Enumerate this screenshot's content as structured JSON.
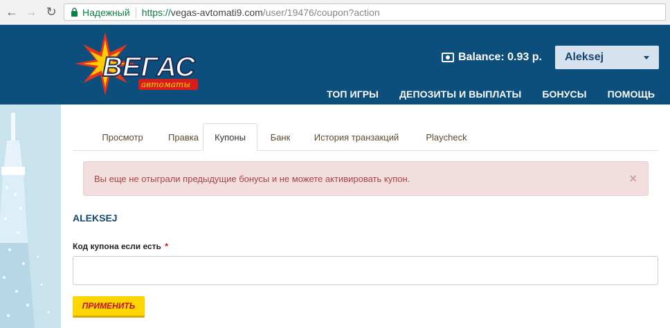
{
  "browser": {
    "secure_label": "Надежный",
    "url_scheme": "https://",
    "url_host": "vegas-avtomati9.com",
    "url_path": "/user/19476/coupon?action"
  },
  "header": {
    "logo_text": "ВЕГАС",
    "logo_subtext": "автоматы",
    "balance": "Balance: 0.93 р.",
    "user_name": "Aleksej",
    "nav": [
      "ТОП ИГРЫ",
      "ДЕПОЗИТЫ И ВЫПЛАТЫ",
      "БОНУСЫ",
      "ПОМОЩЬ"
    ]
  },
  "tabs": [
    {
      "label": "Просмотр",
      "active": false
    },
    {
      "label": "Правка",
      "active": false
    },
    {
      "label": "Купоны",
      "active": true
    },
    {
      "label": "Банк",
      "active": false
    },
    {
      "label": "История транзакций",
      "active": false
    },
    {
      "label": "Playcheck",
      "active": false
    }
  ],
  "alert": {
    "message": "Вы еще не отыграли предыдущие бонусы и не можете активировать купон.",
    "close": "×"
  },
  "form": {
    "username": "ALEKSEJ",
    "coupon_label": "Код купона если есть",
    "required_mark": "*",
    "coupon_value": "",
    "apply_label": "ПРИМЕНИТЬ"
  },
  "colors": {
    "header_bg": "#0c4e7c",
    "alert_bg": "#f2dede",
    "alert_text": "#a94442",
    "button_bg": "#ffd500",
    "button_text": "#c0101a"
  }
}
